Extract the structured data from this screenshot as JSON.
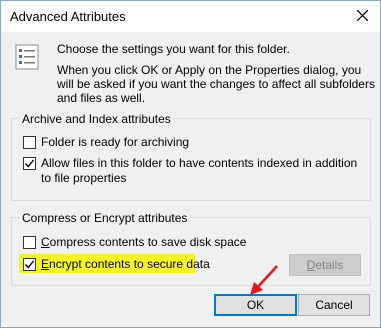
{
  "window": {
    "title": "Advanced Attributes"
  },
  "info": {
    "line1": "Choose the settings you want for this folder.",
    "line2": "When you click OK or Apply on the Properties dialog, you will be asked if you want the changes to affect all subfolders and files as well."
  },
  "archive_group": {
    "title": "Archive and Index attributes",
    "items": [
      {
        "label": "Folder is ready for archiving",
        "checked": false
      },
      {
        "label": "Allow files in this folder to have contents indexed in addition to file properties",
        "checked": true
      }
    ]
  },
  "compress_group": {
    "title": "Compress or Encrypt attributes",
    "items": [
      {
        "label": "Compress contents to save disk space",
        "checked": false
      },
      {
        "label": "Encrypt contents to secure data",
        "checked": true
      }
    ],
    "details_label": "Details"
  },
  "buttons": {
    "ok": "OK",
    "cancel": "Cancel"
  },
  "colors": {
    "highlight": "#f4f427",
    "arrow": "#e8161b",
    "focus": "#0078d7"
  }
}
